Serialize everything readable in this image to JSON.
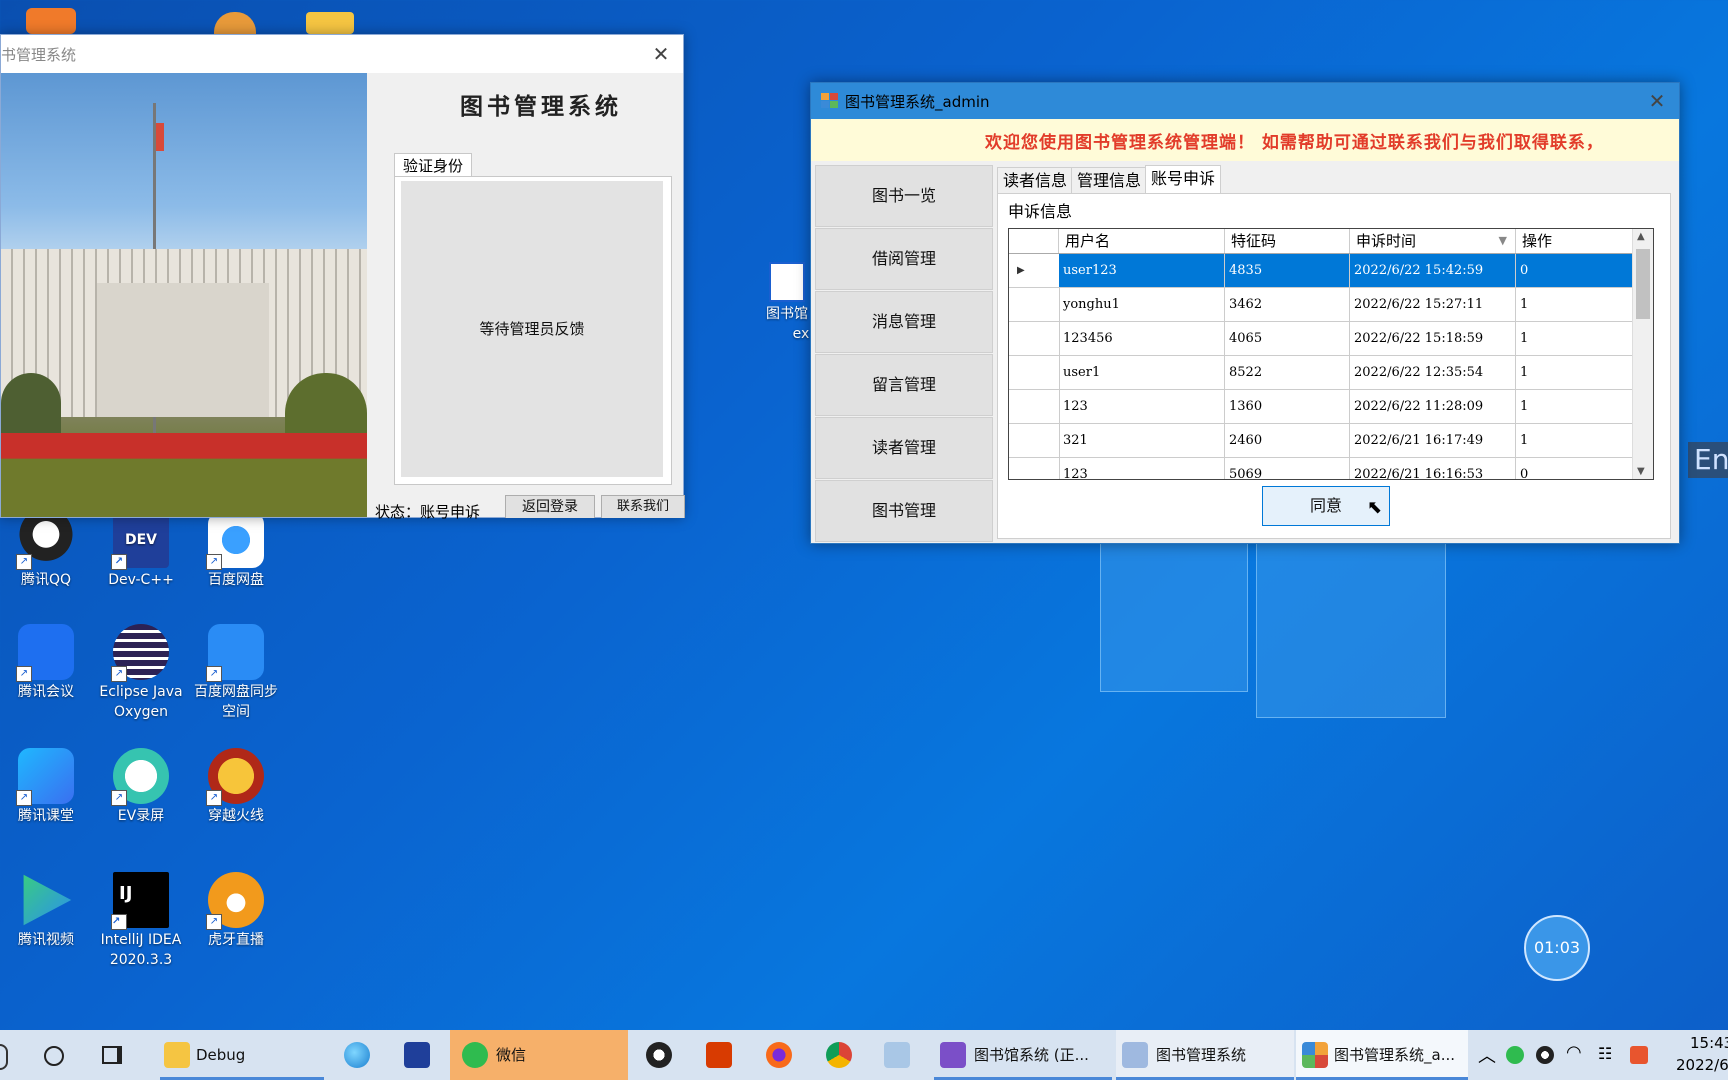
{
  "desktop": {
    "icons": [
      {
        "label": "腾讯QQ",
        "icon": "qq-icon"
      },
      {
        "label": "Dev-C++",
        "icon": "devcpp-icon"
      },
      {
        "label": "百度网盘",
        "icon": "baidu-netdisk-icon"
      },
      {
        "label": "腾讯会议",
        "icon": "tencent-meeting-icon"
      },
      {
        "label": "Eclipse Java Oxygen",
        "icon": "eclipse-icon"
      },
      {
        "label": "百度网盘同步空间",
        "icon": "baidu-sync-icon"
      },
      {
        "label": "腾讯课堂",
        "icon": "tencent-classroom-icon"
      },
      {
        "label": "EV录屏",
        "icon": "ev-recorder-icon"
      },
      {
        "label": "穿越火线",
        "icon": "crossfire-icon"
      },
      {
        "label": "腾讯视频",
        "icon": "tencent-video-icon"
      },
      {
        "label": "IntelliJ IDEA 2020.3.3",
        "icon": "intellij-icon"
      },
      {
        "label": "虎牙直播",
        "icon": "huya-icon"
      }
    ],
    "partial_icon_label_1": "图书馆",
    "partial_icon_label_2": "ex",
    "ime_indicator": "En",
    "clock_bubble": "01:03"
  },
  "login_window": {
    "title": "书管理系统",
    "heading": "图书管理系统",
    "tab_label": "验证身份",
    "wait_text": "等待管理员反馈",
    "status_text": "状态：账号申诉",
    "back_button": "返回登录",
    "contact_button": "联系我们"
  },
  "admin_window": {
    "title": "图书管理系统_admin",
    "marquee": "欢迎您使用图书管理系统管理端！ 如需帮助可通过联系我们与我们取得联系，",
    "sidebar": [
      "图书一览",
      "借阅管理",
      "消息管理",
      "留言管理",
      "读者管理",
      "图书管理"
    ],
    "tabs": [
      "读者信息",
      "管理信息",
      "账号申诉"
    ],
    "active_tab": "账号申诉",
    "section_label": "申诉信息",
    "grid": {
      "columns": [
        "用户名",
        "特征码",
        "申诉时间",
        "操作"
      ],
      "rows": [
        [
          "user123",
          "4835",
          "2022/6/22 15:42:59",
          "0"
        ],
        [
          "yonghu1",
          "3462",
          "2022/6/22 15:27:11",
          "1"
        ],
        [
          "123456",
          "4065",
          "2022/6/22 15:18:59",
          "1"
        ],
        [
          "user1",
          "8522",
          "2022/6/22 12:35:54",
          "1"
        ],
        [
          "123",
          "1360",
          "2022/6/22 11:28:09",
          "1"
        ],
        [
          "321",
          "2460",
          "2022/6/21 16:17:49",
          "1"
        ],
        [
          "123",
          "5069",
          "2022/6/21 16:16:53",
          "0"
        ]
      ],
      "selected_row": 0
    },
    "agree_button": "同意"
  },
  "taskbar": {
    "folder_label": "Debug",
    "wechat_label": "微信",
    "vs_label": "图书馆系统 (正...",
    "app1_label": "图书管理系统",
    "app2_label": "图书管理系统_a...",
    "time": "15:43",
    "date": "2022/6"
  }
}
